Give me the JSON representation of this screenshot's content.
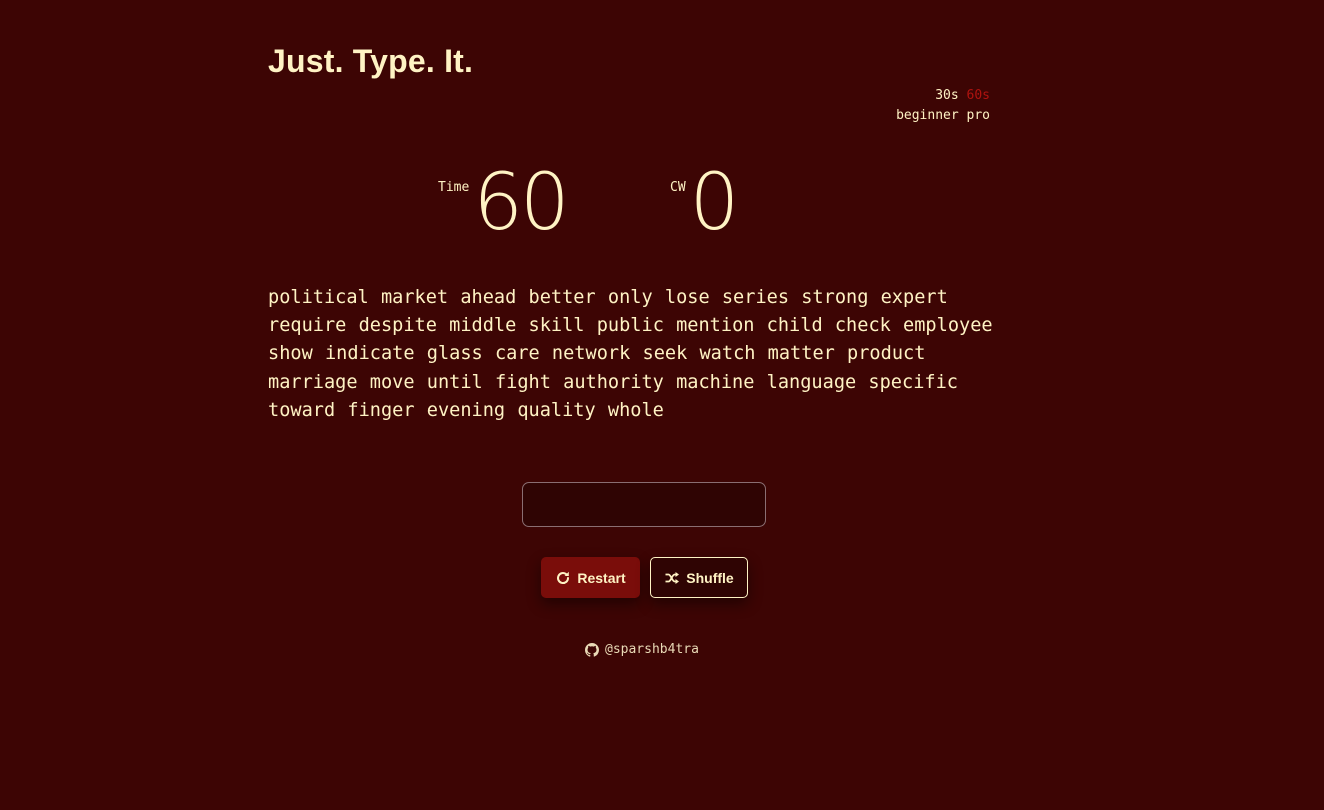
{
  "app": {
    "title": "Just. Type. It."
  },
  "options": {
    "durations": [
      {
        "label": "30s",
        "active": false
      },
      {
        "label": "60s",
        "active": true
      }
    ],
    "levels": [
      {
        "label": "beginner",
        "active": false
      },
      {
        "label": "pro",
        "active": false
      }
    ]
  },
  "stats": {
    "time_label": "Time",
    "time_value": "60",
    "cw_label": "CW",
    "cw_value": "0"
  },
  "words": [
    "political",
    "market",
    "ahead",
    "better",
    "only",
    "lose",
    "series",
    "strong",
    "expert",
    "require",
    "despite",
    "middle",
    "skill",
    "public",
    "mention",
    "child",
    "check",
    "employee",
    "show",
    "indicate",
    "glass",
    "care",
    "network",
    "seek",
    "watch",
    "matter",
    "product",
    "marriage",
    "move",
    "until",
    "fight",
    "authority",
    "machine",
    "language",
    "specific",
    "toward",
    "finger",
    "evening",
    "quality",
    "whole"
  ],
  "input": {
    "value": "",
    "placeholder": ""
  },
  "buttons": {
    "restart_label": "Restart",
    "shuffle_label": "Shuffle"
  },
  "footer": {
    "handle": "@sparshb4tra",
    "icon": "github-icon"
  },
  "colors": {
    "background": "#3d0504",
    "text": "#fff3c4",
    "accent": "#b0130f",
    "restart_button": "#7a0d0a"
  }
}
